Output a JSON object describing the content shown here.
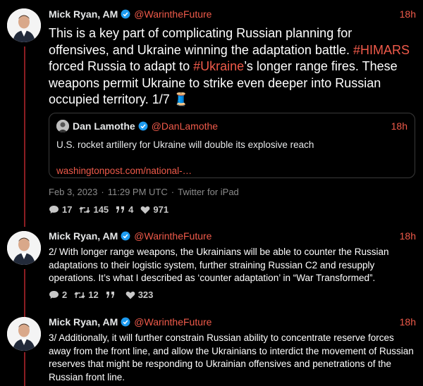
{
  "tweets": [
    {
      "name": "Mick Ryan, AM",
      "handle": "@WarintheFuture",
      "time": "18h",
      "text_parts": {
        "p1": "This is a key part of complicating Russian planning for offensives, and Ukraine winning the adaptation battle. ",
        "tag1": "#HIMARS",
        "p2": " forced Russia to adapt to ",
        "tag2": "#Ukraine",
        "p3": "’s longer range fires. These weapons permit Ukraine to strike even deeper into Russian occupied territory. 1/7 ",
        "emoji": "🧵"
      },
      "quote": {
        "name": "Dan Lamothe",
        "handle": "@DanLamothe",
        "time": "18h",
        "text": "U.S. rocket artillery for Ukraine will double its explosive reach",
        "link": "washingtonpost.com/national-…"
      },
      "meta": {
        "date": "Feb 3, 2023",
        "time": "11:29 PM UTC",
        "client": "Twitter for iPad",
        "sep": "·"
      },
      "stats": {
        "replies": "17",
        "retweets": "145",
        "quotes": "4",
        "likes": "971"
      }
    },
    {
      "name": "Mick Ryan, AM",
      "handle": "@WarintheFuture",
      "time": "18h",
      "text": "2/ With longer range weapons, the Ukrainians will be able to counter the Russian adaptations to their logistic system, further straining Russian C2 and resupply operations. It’s what I described as ‘counter adaptation’ in “War Transformed”.",
      "stats": {
        "replies": "2",
        "retweets": "12",
        "quotes": "",
        "likes": "323"
      }
    },
    {
      "name": "Mick Ryan, AM",
      "handle": "@WarintheFuture",
      "time": "18h",
      "text": "3/ Additionally, it will further constrain Russian ability to concentrate reserve forces away from the front line, and allow the Ukrainians to interdict the movement of Russian reserves that might be responding to Ukrainian offensives and penetrations of the Russian front line."
    }
  ],
  "icons": {
    "verified": "verified-badge-icon",
    "reply": "comment-icon",
    "retweet": "retweet-icon",
    "quote": "quote-icon",
    "like": "heart-icon"
  },
  "colors": {
    "accent": "#ef5a4a",
    "verified": "#1d9bf0",
    "thread_line": "#8b1d22",
    "background": "#000000"
  }
}
